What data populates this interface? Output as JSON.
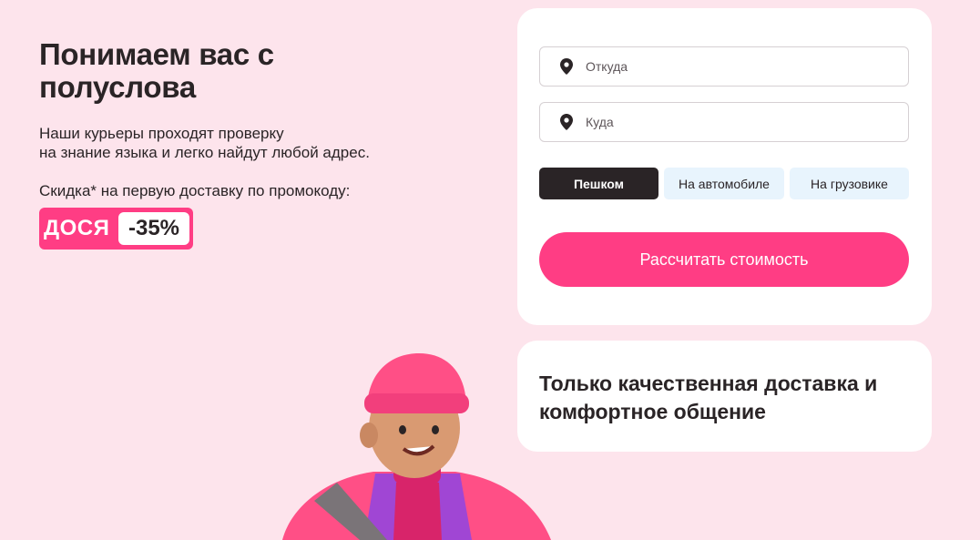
{
  "hero": {
    "title": "Понимаем вас с полуслова",
    "text_line1": "Наши курьеры проходят проверку",
    "text_line2": "на знание языка и легко найдут любой адрес.",
    "promo_caption": "Скидка* на первую доставку по промокоду:",
    "promo_code": "ДОСЯ",
    "promo_discount": "-35%"
  },
  "form": {
    "from_placeholder": "Откуда",
    "to_placeholder": "Куда",
    "from_icon": "map-pin-icon",
    "to_icon": "map-pin-icon",
    "transport_options": [
      "Пешком",
      "На автомобиле",
      "На грузовике"
    ],
    "selected_transport": "Пешком",
    "calculate_label": "Рассчитать стоимость"
  },
  "quality": {
    "title": "Только качественная доставка и комфортное общение"
  },
  "colors": {
    "background": "#fde4ec",
    "accent": "#ff3d84",
    "selected": "#2a2426",
    "option": "#e8f4fd"
  }
}
